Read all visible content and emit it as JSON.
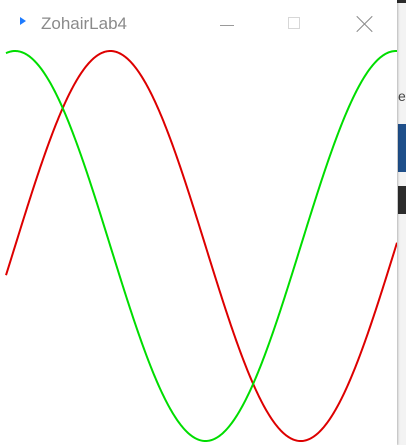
{
  "window": {
    "title": "ZohairLab4",
    "icon": "app-arrow-icon"
  },
  "background_app": {
    "visible_letter": "e"
  },
  "colors": {
    "sine_curve": "#dd0000",
    "cosine_curve": "#00dd00",
    "app_icon": "#1e7bff"
  },
  "curves": [
    {
      "name": "red-curve",
      "color": "#dd0000",
      "x_range_rad": [
        -0.15,
        6.3
      ],
      "phase_rad": 0.0,
      "amplitude": 1.0
    },
    {
      "name": "green-curve",
      "color": "#00dd00",
      "x_range_rad": [
        -0.15,
        6.3
      ],
      "phase_rad": 1.5708,
      "amplitude": 1.0
    }
  ]
}
